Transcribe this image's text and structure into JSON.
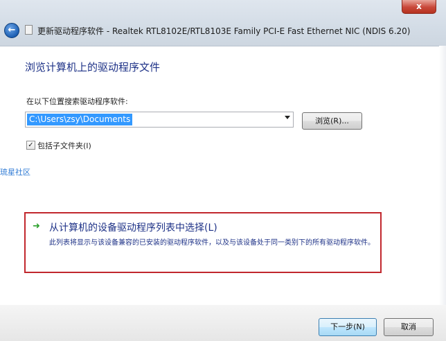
{
  "window": {
    "title": "更新驱动程序软件 - Realtek RTL8102E/RTL8103E Family PCI-E Fast Ethernet NIC (NDIS 6.20)",
    "close_label": "x"
  },
  "main": {
    "heading": "浏览计算机上的驱动程序文件",
    "search_label": "在以下位置搜索驱动程序软件:",
    "path_value": "C:\\Users\\zsy\\Documents",
    "browse_label": "浏览(R)...",
    "include_subfolders_label": "包括子文件夹(I)",
    "include_subfolders_checked": true,
    "watermark": "琉星社区"
  },
  "option": {
    "title": "从计算机的设备驱动程序列表中选择(L)",
    "description": "此列表将显示与该设备兼容的已安装的驱动程序软件，以及与该设备处于同一类别下的所有驱动程序软件。"
  },
  "footer": {
    "next_label": "下一步(N)",
    "cancel_label": "取消"
  },
  "colors": {
    "heading": "#1e3287",
    "highlight_border": "#c1272d",
    "selection": "#3399ff"
  }
}
